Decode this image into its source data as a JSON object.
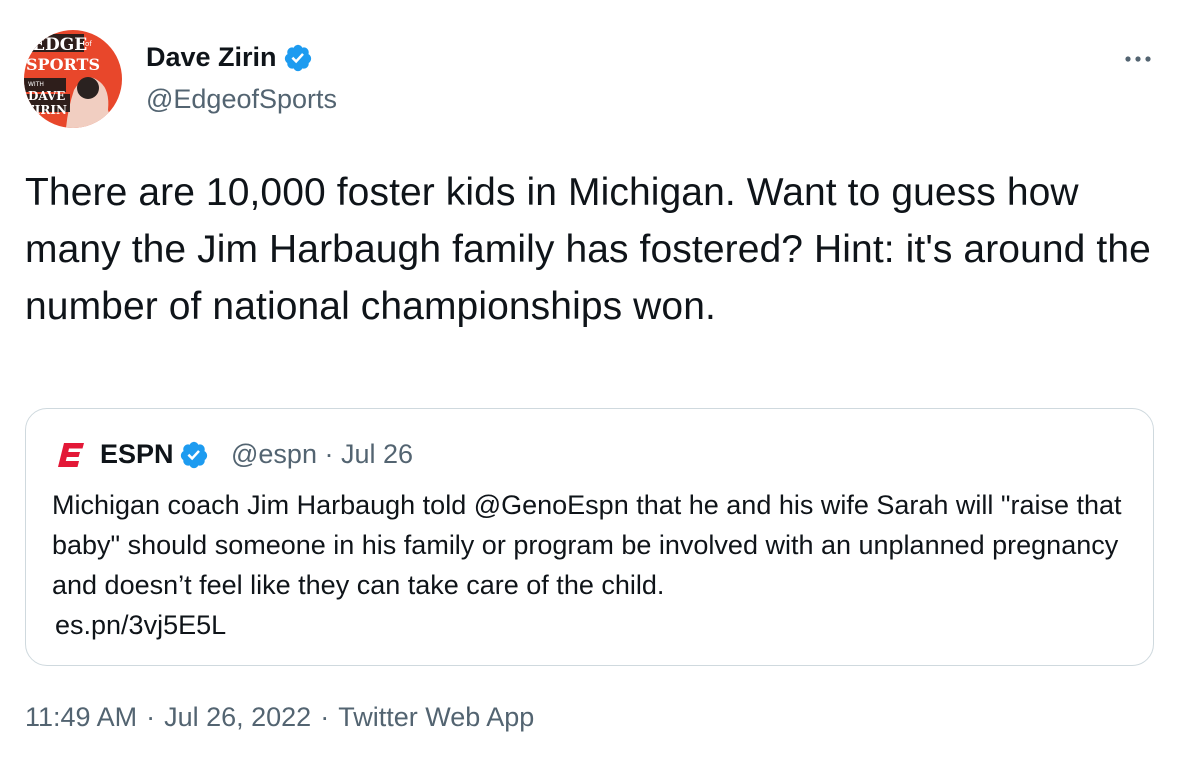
{
  "author": {
    "display_name": "Dave Zirin",
    "handle": "@EdgeofSports",
    "avatar_text": [
      "EDGE",
      "of",
      "SPORTS",
      "WITH",
      "DAVE",
      "ZIRIN"
    ]
  },
  "tweet": {
    "text": "There are 10,000 foster kids in Michigan. Want to guess how many the Jim Harbaugh family has fostered? Hint: it's around the number of national championships won."
  },
  "quoted_tweet": {
    "display_name": "ESPN",
    "meta": "@espn · Jul 26",
    "text": "Michigan coach Jim Harbaugh told @GenoEspn that he and his wife Sarah will \"raise that baby\" should someone in his family or program be involved with an unplanned pregnancy and doesn’t feel like they can take care of the child.",
    "link": "es.pn/3vj5E5L"
  },
  "footer": {
    "time": "11:49 AM",
    "date": "Jul 26, 2022",
    "source": "Twitter Web App",
    "separator": "·"
  },
  "colors": {
    "text_primary": "#0f1419",
    "text_secondary": "#536471",
    "verified_blue": "#1d9bf0",
    "espn_red": "#e31837",
    "border": "#cfd9de",
    "avatar_bg": "#e8472b"
  },
  "icons": {
    "verified": "verified-badge-icon",
    "more": "more-options-icon",
    "espn": "espn-logo-icon"
  }
}
